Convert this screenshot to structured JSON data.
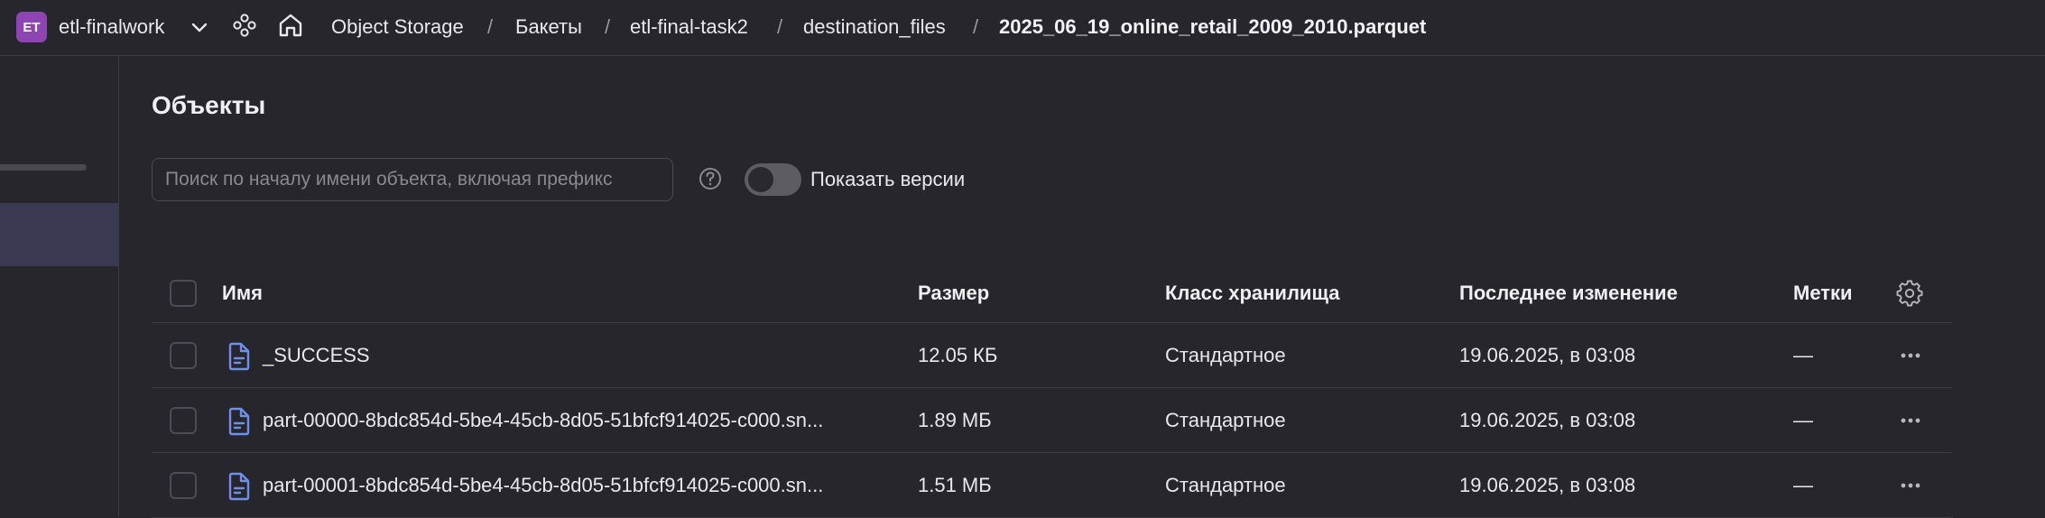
{
  "topbar": {
    "cloud_badge": "ET",
    "cloud_name": "etl-finalwork",
    "breadcrumbs": [
      {
        "label": "Object Storage"
      },
      {
        "label": "Бакеты"
      },
      {
        "label": "etl-final-task2"
      },
      {
        "label": "destination_files"
      },
      {
        "label": "2025_06_19_online_retail_2009_2010.parquet"
      }
    ],
    "separator": "/"
  },
  "main": {
    "title": "Объекты",
    "search_placeholder": "Поиск по началу имени объекта, включая префикс",
    "search_value": "",
    "show_versions_label": "Показать версии",
    "show_versions_on": false
  },
  "table": {
    "columns": {
      "name": "Имя",
      "size": "Размер",
      "storage_class": "Класс хранилища",
      "modified": "Последнее изменение",
      "tags": "Метки"
    },
    "rows": [
      {
        "name": "_SUCCESS",
        "size": "12.05 КБ",
        "storage_class": "Стандартное",
        "modified": "19.06.2025, в 03:08",
        "tags": "—"
      },
      {
        "name": "part-00000-8bdc854d-5be4-45cb-8d05-51bfcf914025-c000.sn...",
        "size": "1.89 МБ",
        "storage_class": "Стандартное",
        "modified": "19.06.2025, в 03:08",
        "tags": "—"
      },
      {
        "name": "part-00001-8bdc854d-5be4-45cb-8d05-51bfcf914025-c000.sn...",
        "size": "1.51 МБ",
        "storage_class": "Стандартное",
        "modified": "19.06.2025, в 03:08",
        "tags": "—"
      }
    ]
  },
  "colors": {
    "background": "#27262d",
    "badge": "#8e44b3",
    "file_icon": "#6f8fe8",
    "selected_sidebar": "#3a3b52"
  }
}
